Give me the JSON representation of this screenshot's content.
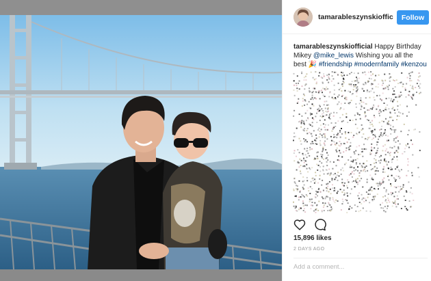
{
  "post": {
    "username": "tamarableszynskioffic",
    "follow_label": "Follow",
    "caption": {
      "username": "tamarableszynskiofficial",
      "text_1": " Happy Birthday Mikey ",
      "mention": "@mike_lewis",
      "text_2": " Wishing you all the best ",
      "emoji": "🎉",
      "hashtags": [
        "#friendship",
        "#modernfamily",
        "#kenzou"
      ]
    },
    "likes": "15,896 likes",
    "timestamp": "2 DAYS AGO",
    "comment_placeholder": "Add a comment..."
  },
  "colors": {
    "follow_button": "#3897f0",
    "link": "#003569",
    "text": "#262626",
    "muted": "#999999"
  },
  "icons": {
    "like": "heart-icon",
    "comment": "comment-icon"
  }
}
